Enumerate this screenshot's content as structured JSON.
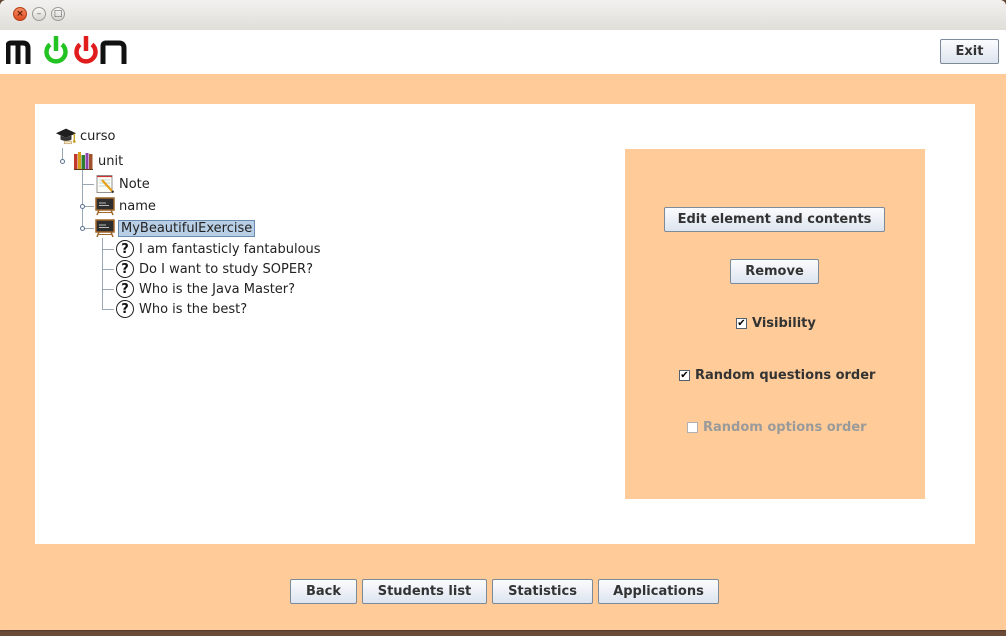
{
  "app": {
    "logo_text": "moon"
  },
  "header": {
    "exit_label": "Exit"
  },
  "tree": {
    "root": "curso",
    "unit": "unit",
    "note": "Note",
    "name": "name",
    "exercise": "MyBeautifulExercise",
    "questions": [
      "I am fantasticly fantabulous",
      "Do I want to study SOPER?",
      "Who is the Java Master?",
      "Who is the best?"
    ]
  },
  "actions": {
    "edit_label": "Edit element and contents",
    "remove_label": "Remove",
    "visibility_label": "Visibility",
    "visibility_checked": true,
    "random_questions_label": "Random questions order",
    "random_questions_checked": true,
    "random_options_label": "Random options order",
    "random_options_checked": false,
    "random_options_enabled": false
  },
  "footer": {
    "back_label": "Back",
    "students_label": "Students list",
    "statistics_label": "Statistics",
    "applications_label": "Applications"
  },
  "colors": {
    "background": "#ffcc99",
    "panel": "#ffffff",
    "selection": "#b8cfe5",
    "logo_green": "#22c322",
    "logo_red": "#e01c1c"
  },
  "icons": {
    "root": "graduation-cap-icon",
    "unit": "books-icon",
    "note": "notepad-pencil-icon",
    "exercise": "chalkboard-icon",
    "question": "question-mark-icon"
  }
}
